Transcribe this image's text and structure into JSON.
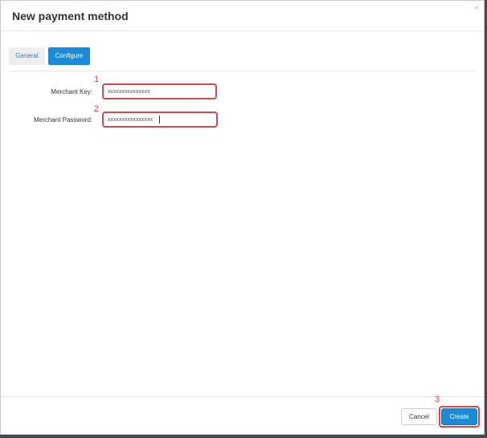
{
  "modal": {
    "title": "New payment method",
    "close_glyph": "×"
  },
  "tabs": [
    {
      "label": "General",
      "active": false
    },
    {
      "label": "Configure",
      "active": true
    }
  ],
  "form": {
    "merchant_key": {
      "label": "Merchant Key:",
      "value": "xxxxxxxxxxxxxxx"
    },
    "merchant_password": {
      "label": "Merchant Password:",
      "value": "xxxxxxxxxxxxxxxx"
    }
  },
  "annotations": {
    "marker_1": "1",
    "marker_2": "2",
    "marker_3": "3",
    "highlight_color": "#d8484d"
  },
  "footer": {
    "cancel_label": "Cancel",
    "create_label": "Create"
  },
  "colors": {
    "primary": "#1b8ad8",
    "backdrop": "#3f4a52"
  }
}
